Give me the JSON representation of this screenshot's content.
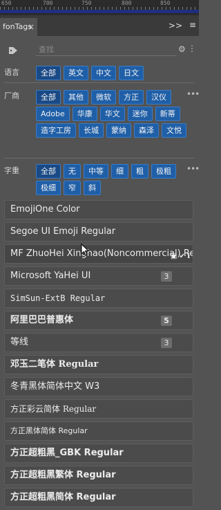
{
  "ruler": {
    "marks": [
      "650",
      "700",
      "750",
      "800",
      "850"
    ]
  },
  "panel": {
    "tab_title": "fonTags",
    "close_glyph": "×",
    "collapse_glyph": ">>",
    "menu_glyph": "≡"
  },
  "search": {
    "placeholder": "查找",
    "value": ""
  },
  "sections": {
    "language": {
      "label": "语言",
      "tags": [
        "全部",
        "英文",
        "中文",
        "日文"
      ]
    },
    "vendor": {
      "label": "厂商",
      "tags": [
        "全部",
        "其他",
        "微软",
        "方正",
        "汉仪",
        "Adobe",
        "华康",
        "华文",
        "迷你",
        "新蒂",
        "造字工房",
        "长城",
        "蒙纳",
        "森泽",
        "文悦"
      ]
    },
    "weight": {
      "label": "字重",
      "tags": [
        "全部",
        "无",
        "中等",
        "细",
        "粗",
        "极粗",
        "极细",
        "窄",
        "斜"
      ]
    }
  },
  "fonts": [
    {
      "name": "EmojiOne Color",
      "count": ""
    },
    {
      "name": "Segoe UI Emoji Regular",
      "count": ""
    },
    {
      "name": "MF ZhuoHei Xinghao(Noncommercial) Regular",
      "count": ""
    },
    {
      "name": "Microsoft YaHei UI",
      "count": "3"
    },
    {
      "name": "SimSun-ExtB Regular",
      "count": ""
    },
    {
      "name": "阿里巴巴普惠体",
      "count": "5"
    },
    {
      "name": "等线",
      "count": "3"
    },
    {
      "name": "邓玉二笔体 Regular",
      "count": ""
    },
    {
      "name": "冬青黑体简体中文 W3",
      "count": ""
    },
    {
      "name": "方正彩云简体 Regular",
      "count": ""
    },
    {
      "name": "方正黑体简体 Regular",
      "count": ""
    },
    {
      "name": "方正超粗黑_GBK Regular",
      "count": ""
    },
    {
      "name": "方正超粗黑繁体 Regular",
      "count": ""
    },
    {
      "name": "方正超粗黑简体 Regular",
      "count": ""
    }
  ]
}
